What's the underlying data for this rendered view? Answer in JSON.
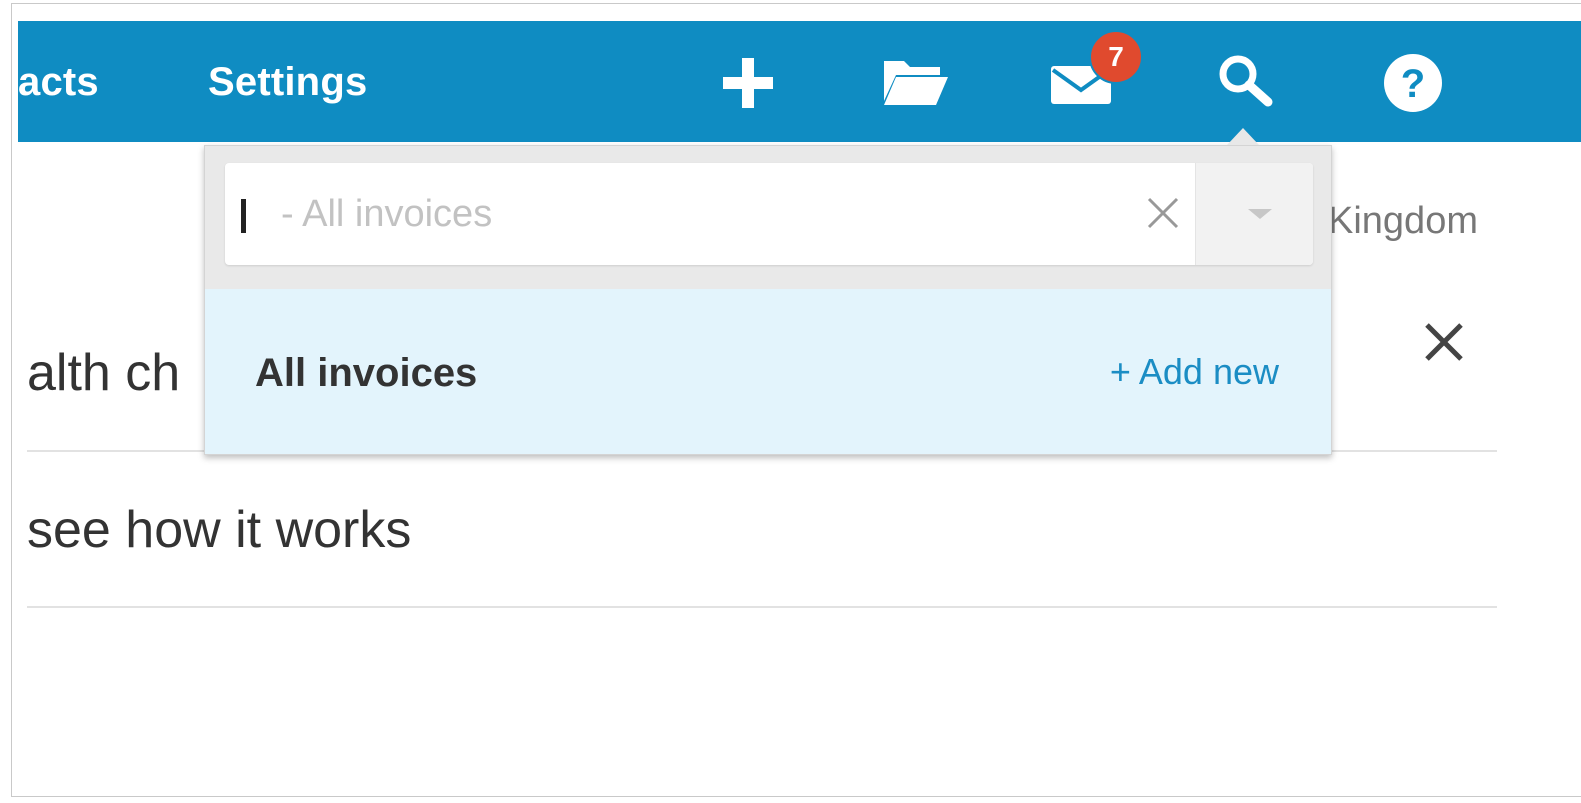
{
  "nav": {
    "contacts_label": "acts",
    "settings_label": "Settings",
    "badge_count": "7",
    "icons": [
      "plus-icon",
      "folder-open-icon",
      "envelope-icon",
      "search-icon",
      "question-circle-icon"
    ],
    "bar_color": "#0f8cc2",
    "badge_color": "#e04a2e"
  },
  "search": {
    "placeholder": "- All invoices",
    "value": "",
    "clear_glyph": "✕"
  },
  "dropdown": {
    "result_label": "All invoices",
    "add_new_label": "+ Add new",
    "result_bg": "#e3f4fc"
  },
  "background": {
    "location_text": "Kingdom",
    "row1_text": "alth ch",
    "row2_text": "see how it works"
  }
}
